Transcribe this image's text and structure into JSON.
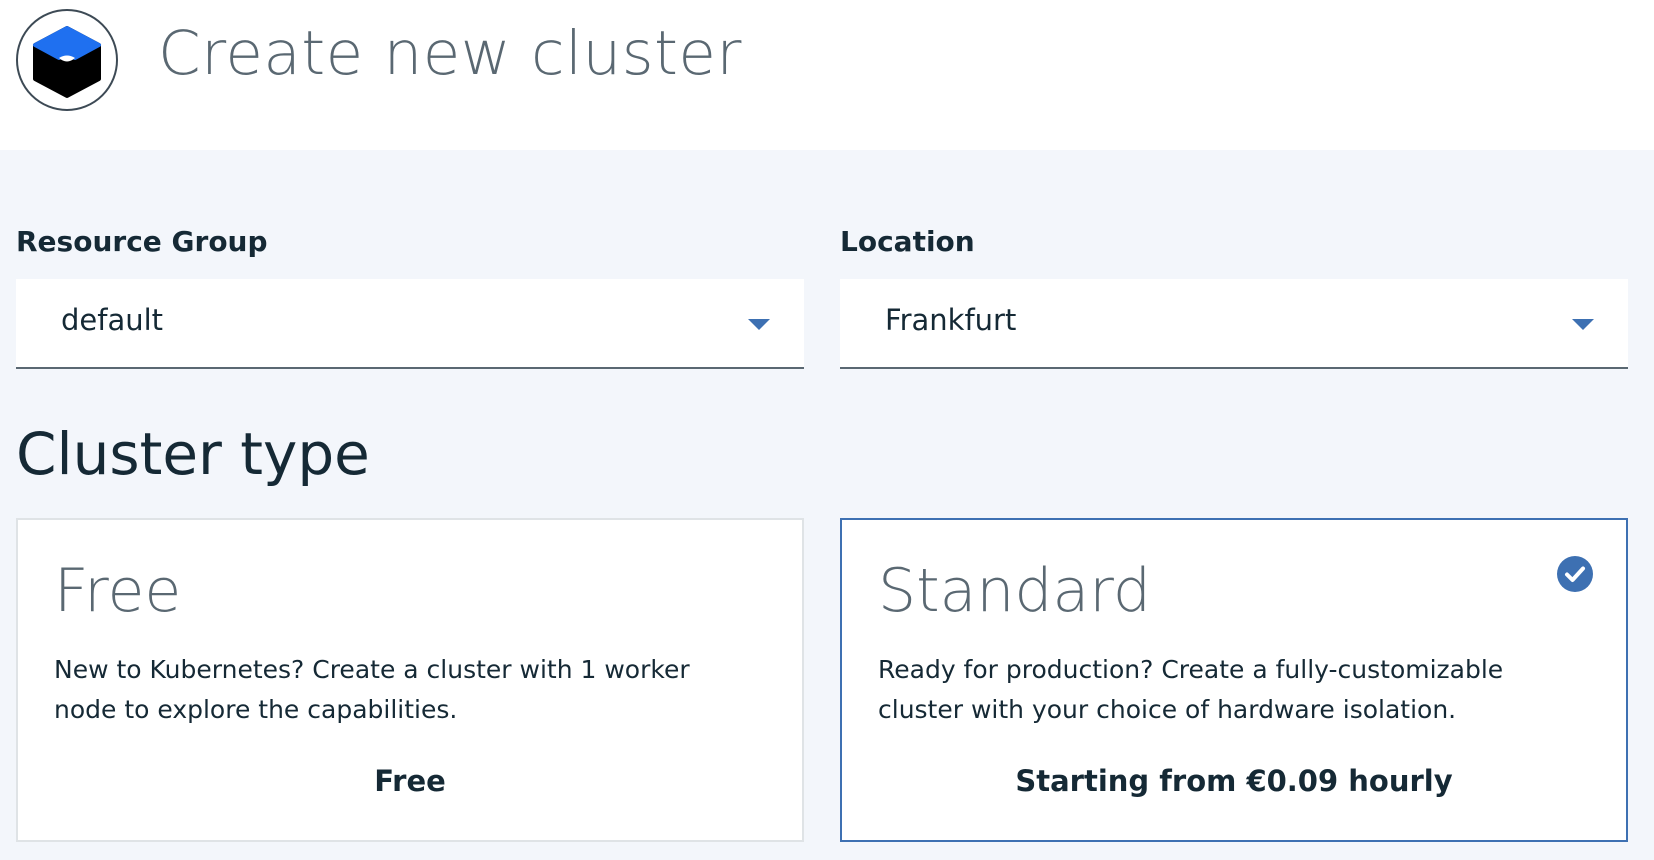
{
  "header": {
    "logo_icon": "kubernetes-cluster-cube-icon",
    "title": "Create new cluster"
  },
  "resource_group": {
    "label": "Resource Group",
    "value": "default"
  },
  "location": {
    "label": "Location",
    "value": "Frankfurt"
  },
  "cluster_type": {
    "title": "Cluster type",
    "tiles": [
      {
        "title": "Free",
        "description": "New to Kubernetes? Create a cluster with 1 worker node to explore the capabilities.",
        "price": "Free",
        "selected": false
      },
      {
        "title": "Standard",
        "description": "Ready for production? Create a fully-customizable cluster with your choice of hardware isolation.",
        "price": "Starting from €0.09 hourly",
        "selected": true
      }
    ]
  },
  "colors": {
    "accent": "#3d70b2",
    "logo_top": "#1f70f0",
    "logo_body": "#000000",
    "page_bg": "#f3f6fb",
    "text": "#152935",
    "muted_text": "#5a6872"
  }
}
